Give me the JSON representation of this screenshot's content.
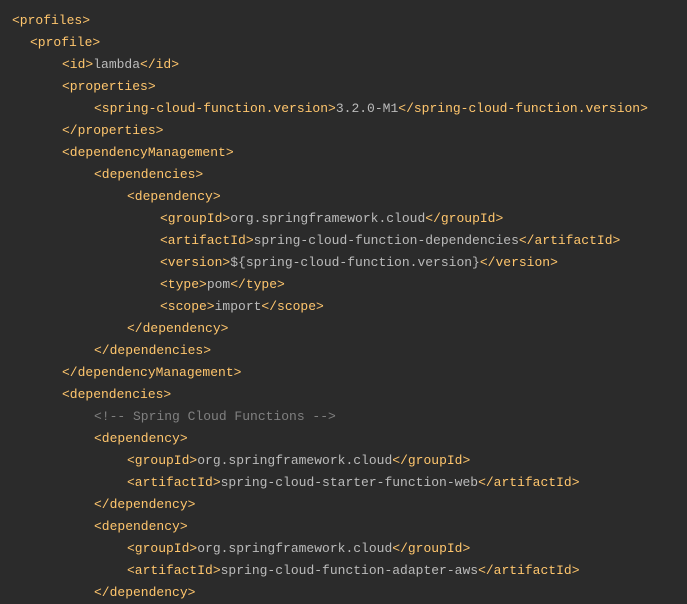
{
  "tags": {
    "profiles_open": "<profiles>",
    "profile_open": "<profile>",
    "id_open": "<id>",
    "id_val": "lambda",
    "id_close": "</id>",
    "properties_open": "<properties>",
    "scf_version_open": "<spring-cloud-function.version>",
    "scf_version_val": "3.2.0-M1",
    "scf_version_close": "</spring-cloud-function.version>",
    "properties_close": "</properties>",
    "depMgmt_open": "<dependencyManagement>",
    "dependencies_open": "<dependencies>",
    "dependency_open": "<dependency>",
    "groupId_open": "<groupId>",
    "groupId_val": "org.springframework.cloud",
    "groupId_close": "</groupId>",
    "artifactId_open": "<artifactId>",
    "artifactId_val1": "spring-cloud-function-dependencies",
    "artifactId_close": "</artifactId>",
    "version_open": "<version>",
    "version_var": "${spring-cloud-function.version}",
    "version_close": "</version>",
    "type_open": "<type>",
    "type_val": "pom",
    "type_close": "</type>",
    "scope_open": "<scope>",
    "scope_val": "import",
    "scope_close": "</scope>",
    "dependency_close": "</dependency>",
    "dependencies_close": "</dependencies>",
    "depMgmt_close": "</dependencyManagement>",
    "comment_spring": "<!-- Spring Cloud Functions -->",
    "artifactId_val2": "spring-cloud-starter-function-web",
    "artifactId_val3": "spring-cloud-function-adapter-aws"
  }
}
